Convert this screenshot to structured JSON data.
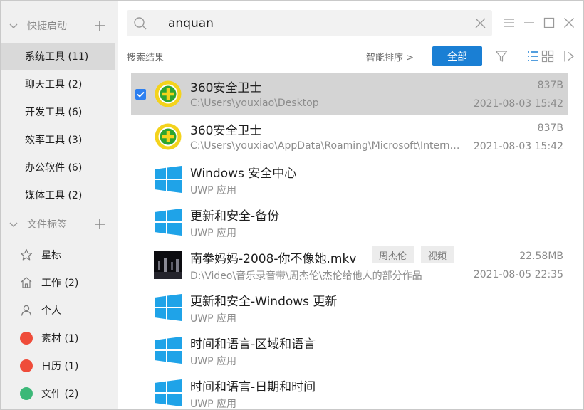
{
  "sidebar": {
    "quick_launch_title": "快捷启动",
    "quick_items": [
      {
        "label": "系统工具 (11)",
        "active": true
      },
      {
        "label": "聊天工具 (2)"
      },
      {
        "label": "开发工具 (6)"
      },
      {
        "label": "效率工具 (3)"
      },
      {
        "label": "办公软件 (6)"
      },
      {
        "label": "媒体工具 (2)"
      }
    ],
    "file_tags_title": "文件标签",
    "tag_items": [
      {
        "label": "星标",
        "icon": "star-icon"
      },
      {
        "label": "工作 (2)",
        "icon": "home-icon"
      },
      {
        "label": "个人",
        "icon": "person-icon"
      },
      {
        "label": "素材 (1)",
        "icon": "red-dot-icon",
        "color": "#ef4c3a"
      },
      {
        "label": "日历 (1)",
        "icon": "red-dot-icon",
        "color": "#ef4c3a"
      },
      {
        "label": "文件 (2)",
        "icon": "green-dot-icon",
        "color": "#3cb878"
      }
    ]
  },
  "search": {
    "value": "anquan"
  },
  "toolbar": {
    "results_label": "搜索结果",
    "sort_label": "智能排序 >",
    "all_label": "全部"
  },
  "colors": {
    "accent": "#1a7fd4",
    "checkbox": "#2c7ff0"
  },
  "results": [
    {
      "name": "360安全卫士",
      "path": "C:\\Users\\youxiao\\Desktop",
      "size": "837B",
      "date": "2021-08-03 15:42",
      "icon": "360-safe-icon",
      "selected": true
    },
    {
      "name": "360安全卫士",
      "path": "C:\\Users\\youxiao\\AppData\\Roaming\\Microsoft\\Internet Explorer",
      "size": "837B",
      "date": "2021-08-03 15:42",
      "icon": "360-safe-icon"
    },
    {
      "name": "Windows 安全中心",
      "path": "UWP 应用",
      "size": "",
      "date": "",
      "icon": "windows-icon"
    },
    {
      "name": "更新和安全-备份",
      "path": "UWP 应用",
      "size": "",
      "date": "",
      "icon": "windows-icon"
    },
    {
      "name": "南拳妈妈-2008-你不像她.mkv",
      "path": "D:\\Video\\音乐录音带\\周杰伦\\杰伦给他人的部分作品",
      "size": "22.58MB",
      "date": "2021-08-05 22:35",
      "icon": "video-thumbnail-icon",
      "tags": [
        "周杰伦",
        "视频"
      ]
    },
    {
      "name": "更新和安全-Windows 更新",
      "path": "UWP 应用",
      "size": "",
      "date": "",
      "icon": "windows-icon"
    },
    {
      "name": "时间和语言-区域和语言",
      "path": "UWP 应用",
      "size": "",
      "date": "",
      "icon": "windows-icon"
    },
    {
      "name": "时间和语言-日期和时间",
      "path": "UWP 应用",
      "size": "",
      "date": "",
      "icon": "windows-icon"
    }
  ]
}
